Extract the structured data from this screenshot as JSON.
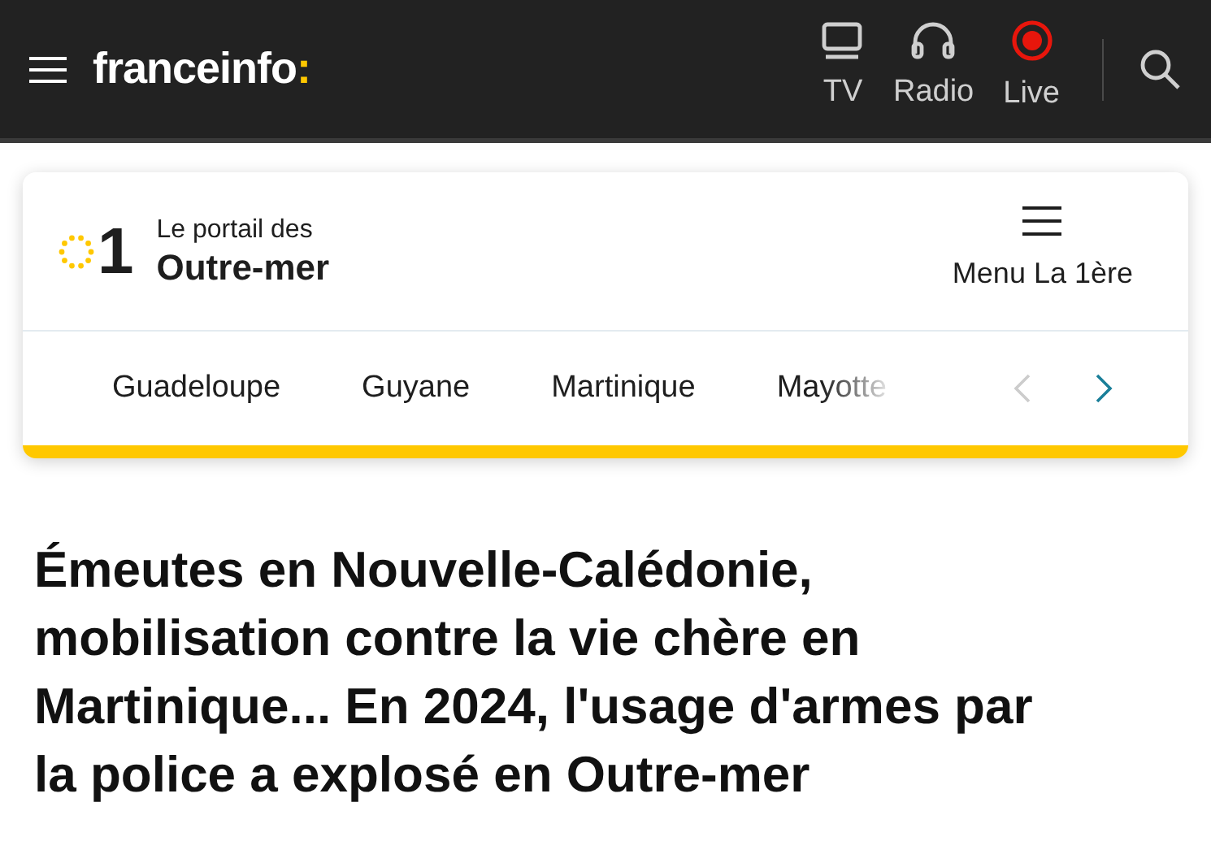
{
  "header": {
    "logo": {
      "name": "franceinfo",
      "mark": ":"
    },
    "nav": [
      {
        "label": "TV",
        "kind": "tv"
      },
      {
        "label": "Radio",
        "kind": "radio"
      },
      {
        "label": "Live",
        "kind": "live"
      }
    ]
  },
  "portal": {
    "logo_digit": "1",
    "tagline": "Le portail des",
    "name": "Outre-mer",
    "menu_label": "Menu La 1ère",
    "regions": [
      {
        "label": "Guadeloupe",
        "faded": false
      },
      {
        "label": "Guyane",
        "faded": false
      },
      {
        "label": "Martinique",
        "faded": false
      },
      {
        "label": "Mayotte",
        "faded": true
      }
    ],
    "prev_disabled": true,
    "next_disabled": false
  },
  "headline": "Émeutes en Nouvelle-Calédonie, mobilisation contre la vie chère en Martinique... En 2024, l'usage d'armes par la police a explosé en Outre-mer"
}
